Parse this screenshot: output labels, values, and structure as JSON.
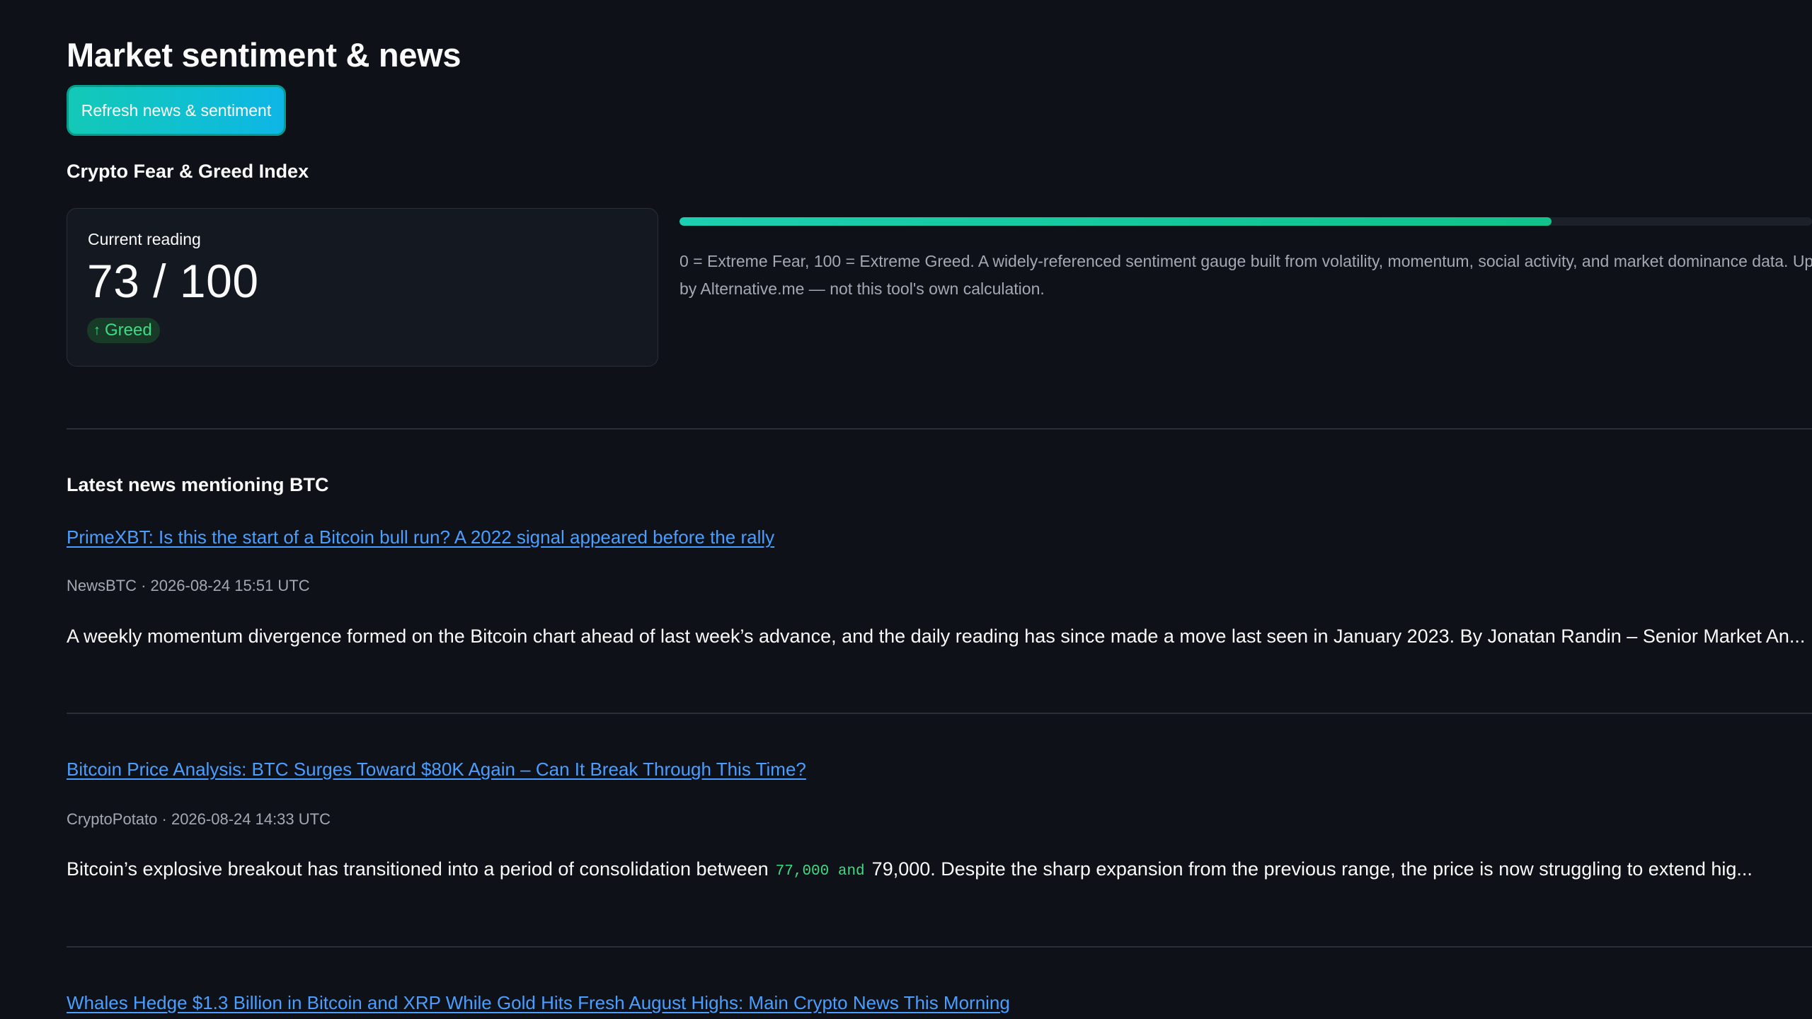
{
  "page": {
    "title": "Market sentiment & news",
    "refresh_button_label": "Refresh news & sentiment"
  },
  "fear_greed": {
    "section_title": "Crypto Fear & Greed Index",
    "card_label": "Current reading",
    "value": 73,
    "max": 100,
    "value_display": "73 / 100",
    "classification": "Greed",
    "badge_icon": "arrow-up-icon",
    "badge_color": "#3ddc84",
    "gauge_fraction": 0.73,
    "gauge_color": "#14c79a",
    "caption": "0 = Extreme Fear, 100 = Extreme Greed. A widely-referenced sentiment gauge built from volatility, momentum, social activity, and market dominance data. Up daily by Alternative.me — not this tool's own calculation."
  },
  "news": {
    "heading": "Latest news mentioning BTC",
    "items": [
      {
        "title": "PrimeXBT: Is this the start of a Bitcoin bull run? A 2022 signal appeared before the rally",
        "meta": "NewsBTC · 2026-08-24 15:51 UTC",
        "summary": "A weekly momentum divergence formed on the Bitcoin chart ahead of last week’s advance, and the daily reading has since made a move last seen in January 2023. By Jonatan Randin – Senior Market An..."
      },
      {
        "title": "Bitcoin Price Analysis: BTC Surges Toward $80K Again – Can It Break Through This Time?",
        "meta": "CryptoPotato · 2026-08-24 14:33 UTC",
        "summary_before": "Bitcoin’s explosive breakout has transitioned into a period of consolidation between",
        "summary_code": "77,000 and",
        "summary_after": "79,000. Despite the sharp expansion from the previous range, the price is now struggling to extend hig..."
      },
      {
        "title": "Whales Hedge $1.3 Billion in Bitcoin and XRP While Gold Hits Fresh August Highs: Main Crypto News This Morning"
      }
    ]
  },
  "colors": {
    "background": "#0e1117",
    "link": "#4a9eff",
    "accent": "#13c9b6",
    "card_border": "#2a2e38",
    "muted_text": "#a3a8b4"
  }
}
